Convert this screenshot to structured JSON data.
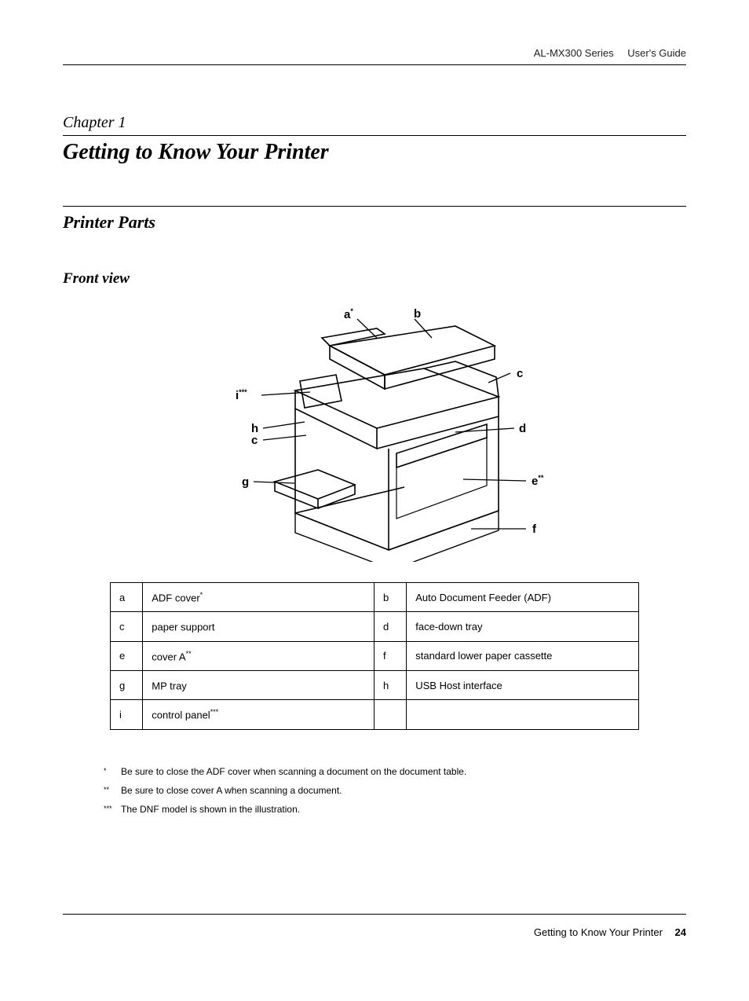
{
  "header": {
    "series": "AL-MX300 Series",
    "doctype": "User's Guide"
  },
  "chapter_label": "Chapter 1",
  "chapter_title": "Getting to Know Your Printer",
  "section_title": "Printer Parts",
  "subsection_title": "Front view",
  "diagram_labels": {
    "a": "a",
    "a_sup": "*",
    "b": "b",
    "c": "c",
    "d": "d",
    "e": "e",
    "e_sup": "**",
    "f": "f",
    "g": "g",
    "h": "h",
    "i": "i",
    "i_sup": "***",
    "c2": "c"
  },
  "table": {
    "rows": [
      {
        "l1": "a",
        "d1": "ADF cover",
        "d1s": "*",
        "l2": "b",
        "d2": "Auto Document Feeder (ADF)"
      },
      {
        "l1": "c",
        "d1": "paper support",
        "d1s": "",
        "l2": "d",
        "d2": "face-down tray"
      },
      {
        "l1": "e",
        "d1": "cover A",
        "d1s": "**",
        "l2": "f",
        "d2": "standard lower paper cassette"
      },
      {
        "l1": "g",
        "d1": "MP tray",
        "d1s": "",
        "l2": "h",
        "d2": "USB Host interface"
      },
      {
        "l1": "i",
        "d1": "control panel",
        "d1s": "***",
        "l2": "",
        "d2": ""
      }
    ]
  },
  "footnotes": {
    "n1": {
      "mark": "*",
      "text": "Be sure to close the ADF cover when scanning a document on the document table."
    },
    "n2": {
      "mark": "**",
      "text": "Be sure to close cover A when scanning a document."
    },
    "n3": {
      "mark": "***",
      "text": "The DNF model is shown in the illustration."
    }
  },
  "footer": {
    "title": "Getting to Know Your Printer",
    "page": "24"
  }
}
